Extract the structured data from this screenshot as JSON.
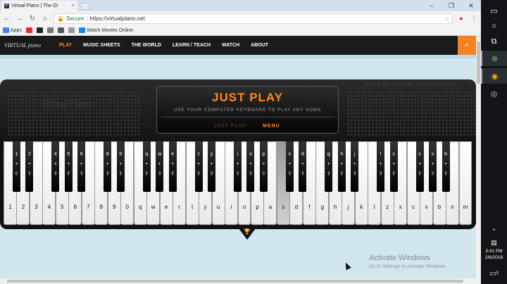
{
  "browser": {
    "tab_title": "Virtual Piano | The Oi",
    "tab_close": "×",
    "url_secure": "Secure",
    "url": "https://virtualpiano.net",
    "bookmarks": [
      {
        "label": "Apps",
        "color": "#4285f4"
      },
      {
        "label": "",
        "color": "#e52d27"
      },
      {
        "label": "",
        "color": "#222222"
      },
      {
        "label": "",
        "color": "#777777"
      },
      {
        "label": "",
        "color": "#555555"
      },
      {
        "label": "",
        "color": "#999999"
      },
      {
        "label": "Watch Movies Online",
        "color": "#1e88e5"
      }
    ],
    "window_controls": [
      "–",
      "❐",
      "✕"
    ]
  },
  "nav": {
    "logo": "VIRTUAL piano",
    "items": [
      {
        "label": "PLAY",
        "active": true
      },
      {
        "label": "MUSIC SHEETS",
        "active": false
      },
      {
        "label": "THE WORLD",
        "active": false
      },
      {
        "label": "LEARN / TEACH",
        "active": false
      },
      {
        "label": "WATCH",
        "active": false
      },
      {
        "label": "ABOUT",
        "active": false
      }
    ],
    "search_icon": "search-icon"
  },
  "piano": {
    "made_by": "MADE BY VIRTUAL MUSIC STUDIO",
    "big_logo": "Virtual Piano",
    "headline": "JUST PLAY",
    "subline": "USE YOUR COMPUTER KEYBOARD TO PLAY ANY SONG",
    "mode_inactive": "JUST PLAY",
    "mode_active": "MENU",
    "white_keys": [
      "1",
      "2",
      "3",
      "4",
      "5",
      "6",
      "7",
      "8",
      "9",
      "0",
      "q",
      "w",
      "e",
      "r",
      "t",
      "y",
      "u",
      "i",
      "o",
      "p",
      "a",
      "s",
      "d",
      "f",
      "g",
      "h",
      "j",
      "k",
      "l",
      "z",
      "x",
      "c",
      "v",
      "b",
      "n",
      "m"
    ],
    "highlighted_white": "s",
    "black_keys": [
      {
        "after": 0,
        "key": "1"
      },
      {
        "after": 1,
        "key": "2"
      },
      {
        "after": 3,
        "key": "4"
      },
      {
        "after": 4,
        "key": "5"
      },
      {
        "after": 5,
        "key": "6"
      },
      {
        "after": 7,
        "key": "8"
      },
      {
        "after": 8,
        "key": "9"
      },
      {
        "after": 10,
        "key": "q"
      },
      {
        "after": 11,
        "key": "w"
      },
      {
        "after": 12,
        "key": "e"
      },
      {
        "after": 14,
        "key": "t"
      },
      {
        "after": 15,
        "key": "y"
      },
      {
        "after": 17,
        "key": "i"
      },
      {
        "after": 18,
        "key": "o"
      },
      {
        "after": 19,
        "key": "p"
      },
      {
        "after": 21,
        "key": "s"
      },
      {
        "after": 22,
        "key": "d"
      },
      {
        "after": 24,
        "key": "g"
      },
      {
        "after": 25,
        "key": "h"
      },
      {
        "after": 26,
        "key": "j"
      },
      {
        "after": 28,
        "key": "l"
      },
      {
        "after": 29,
        "key": "z"
      },
      {
        "after": 31,
        "key": "c"
      },
      {
        "after": 32,
        "key": "v"
      },
      {
        "after": 33,
        "key": "b"
      }
    ],
    "black_shift_glyph": "+",
    "black_arrow_glyph": "⇧"
  },
  "watermark": {
    "line1": "Activate Windows",
    "line2": "Go to Settings to activate Windows."
  },
  "taskbar": {
    "time": "3:41 PM",
    "date": "2/6/2018",
    "notifications": "3"
  },
  "colors": {
    "accent": "#ff8b1a",
    "nav_bg": "#1a1a1a",
    "page_bg": "#d2e6ef"
  }
}
